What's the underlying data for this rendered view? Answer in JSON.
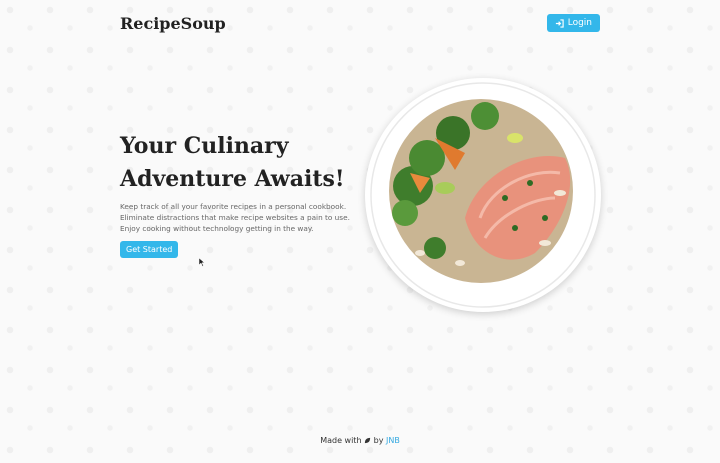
{
  "header": {
    "brand": "RecipeSoup",
    "login_label": "Login"
  },
  "hero": {
    "title": "Your Culinary Adventure Awaits!",
    "description": "Keep track of all your favorite recipes in a personal cookbook. Eliminate distractions that make recipe websites a pain to use. Enjoy cooking without technology getting in the way.",
    "cta_label": "Get Started",
    "image_alt": "salmon-broccoli-quinoa-plate"
  },
  "footer": {
    "made_with": "Made with",
    "by": "by",
    "author": "JNB"
  },
  "icons": {
    "login": "login-arrow-icon",
    "footer": "leaf-icon"
  },
  "colors": {
    "accent": "#33b7ea",
    "link": "#33a8e0",
    "background": "#fafafa"
  }
}
